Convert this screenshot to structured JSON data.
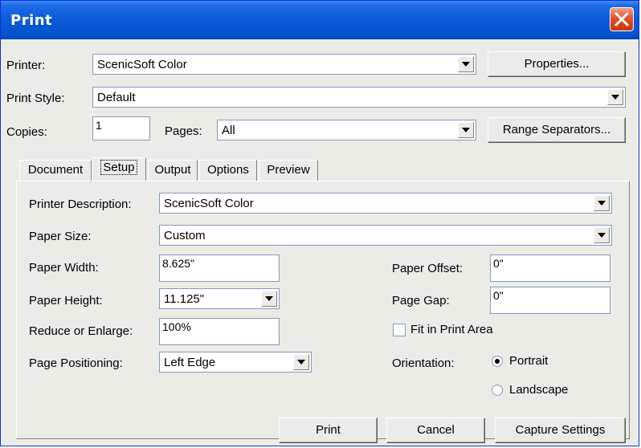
{
  "window": {
    "title": "Print"
  },
  "printer": {
    "label": "Printer:",
    "value": "ScenicSoft Color",
    "properties_button": "Properties..."
  },
  "print_style": {
    "label": "Print Style:",
    "value": "Default"
  },
  "copies": {
    "label": "Copies:",
    "value": "1"
  },
  "pages": {
    "label": "Pages:",
    "value": "All",
    "range_button": "Range Separators..."
  },
  "tabs": [
    "Document",
    "Setup",
    "Output",
    "Options",
    "Preview"
  ],
  "setup": {
    "printer_description": {
      "label": "Printer Description:",
      "value": "ScenicSoft Color"
    },
    "paper_size": {
      "label": "Paper Size:",
      "value": "Custom"
    },
    "paper_width": {
      "label": "Paper Width:",
      "value": "8.625\""
    },
    "paper_height": {
      "label": "Paper Height:",
      "value": "11.125\""
    },
    "reduce_enlarge": {
      "label": "Reduce or Enlarge:",
      "value": "100%"
    },
    "page_positioning": {
      "label": "Page Positioning:",
      "value": "Left Edge"
    },
    "paper_offset": {
      "label": "Paper Offset:",
      "value": "0\""
    },
    "page_gap": {
      "label": "Page Gap:",
      "value": "0\""
    },
    "fit_in_print_area": {
      "label": "Fit in Print Area",
      "checked": false
    },
    "orientation": {
      "label": "Orientation:",
      "portrait": "Portrait",
      "landscape": "Landscape",
      "selected": "portrait"
    }
  },
  "buttons": {
    "print": "Print",
    "cancel": "Cancel",
    "capture": "Capture Settings"
  }
}
